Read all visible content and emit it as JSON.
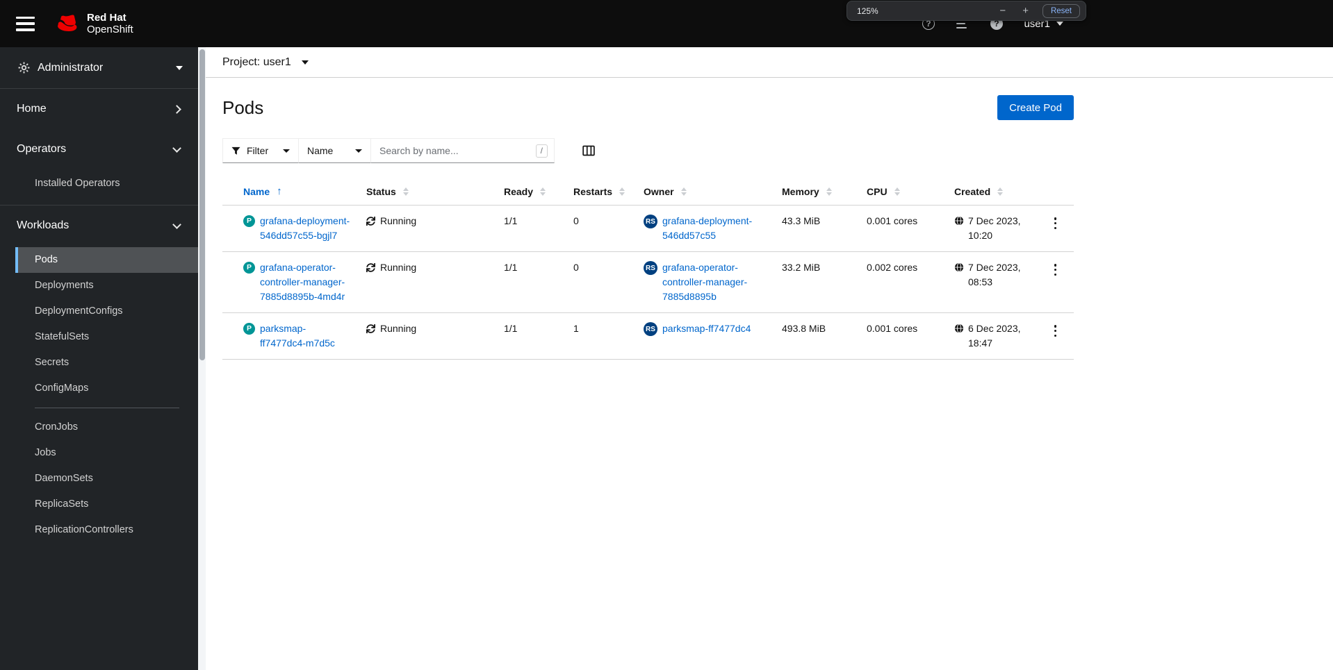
{
  "colors": {
    "accent_blue": "#0066cc",
    "masthead_bg": "#0d0d0d",
    "sidebar_bg": "#212427",
    "nav_selected_bg": "#4f5255",
    "nav_selected_border": "#73bcf7",
    "pod_badge_bg": "#009596",
    "replicaset_badge_bg": "#004080",
    "brand_red": "#ee0000"
  },
  "masthead": {
    "brand_line1": "Red Hat",
    "brand_line2": "OpenShift",
    "help_glyph": "?",
    "info_glyph": "?",
    "user_menu_label": "user1",
    "zoom_popup": {
      "zoom_level": "125%",
      "minus_label": "−",
      "plus_label": "+",
      "reset_label": "Reset"
    }
  },
  "sidebar": {
    "perspective_label": "Administrator",
    "sections": {
      "home_label": "Home",
      "operators_label": "Operators",
      "installed_operators_label": "Installed Operators",
      "workloads_label": "Workloads"
    },
    "workloads_items": [
      "Pods",
      "Deployments",
      "DeploymentConfigs",
      "StatefulSets",
      "Secrets",
      "ConfigMaps",
      "CronJobs",
      "Jobs",
      "DaemonSets",
      "ReplicaSets",
      "ReplicationControllers"
    ],
    "selected_item": "Pods"
  },
  "content": {
    "project_selector": {
      "label": "Project:",
      "value": "user1"
    },
    "page_title": "Pods",
    "create_button_label": "Create Pod",
    "toolbar": {
      "filter_label": "Filter",
      "attribute_label": "Name",
      "search_placeholder": "Search by name...",
      "search_shortcut": "/"
    },
    "table": {
      "columns": [
        "Name",
        "Status",
        "Ready",
        "Restarts",
        "Owner",
        "Memory",
        "CPU",
        "Created"
      ],
      "sort_asc_glyph": "↑",
      "badges": {
        "pod": "P",
        "replicaset": "RS"
      },
      "rows": [
        {
          "name": "grafana-deployment-546dd57c55-bgjl7",
          "status": "Running",
          "ready": "1/1",
          "restarts": "0",
          "owner": "grafana-deployment-546dd57c55",
          "memory": "43.3 MiB",
          "cpu": "0.001 cores",
          "created": "7 Dec 2023, 10:20"
        },
        {
          "name": "grafana-operator-controller-manager-7885d8895b-4md4r",
          "status": "Running",
          "ready": "1/1",
          "restarts": "0",
          "owner": "grafana-operator-controller-manager-7885d8895b",
          "memory": "33.2 MiB",
          "cpu": "0.002 cores",
          "created": "7 Dec 2023, 08:53"
        },
        {
          "name": "parksmap-ff7477dc4-m7d5c",
          "status": "Running",
          "ready": "1/1",
          "restarts": "1",
          "owner": "parksmap-ff7477dc4",
          "memory": "493.8 MiB",
          "cpu": "0.001 cores",
          "created": "6 Dec 2023, 18:47"
        }
      ]
    }
  }
}
